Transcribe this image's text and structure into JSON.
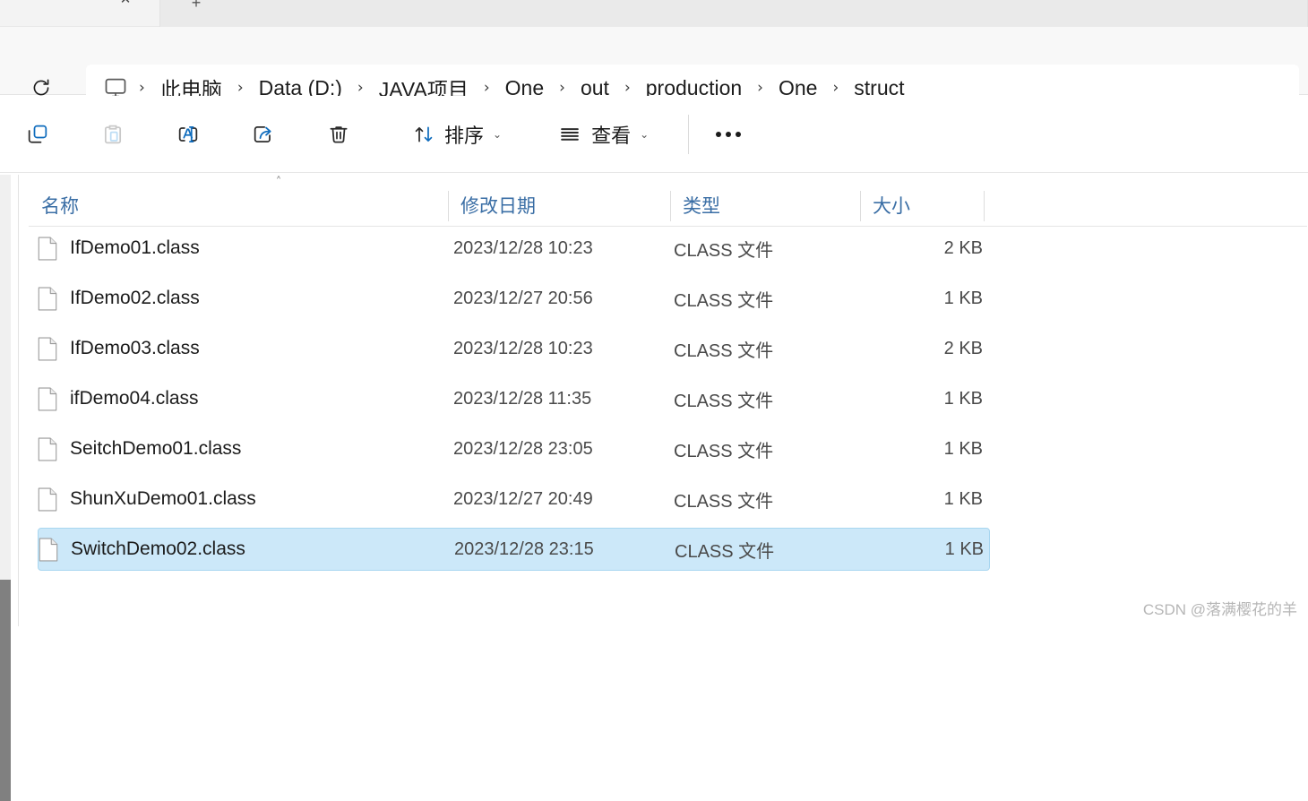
{
  "tabstrip": {
    "close_label": "✕",
    "new_tab_label": "+"
  },
  "address": {
    "refresh_icon": "refresh-icon",
    "pc_icon": "this-pc-monitor-icon",
    "separator": "›",
    "breadcrumbs": [
      "此电脑",
      "Data (D:)",
      "JAVA项目",
      "One",
      "out",
      "production",
      "One",
      "struct"
    ]
  },
  "toolbar": {
    "icons": [
      {
        "name": "copy-icon",
        "state": "enabled"
      },
      {
        "name": "paste-icon",
        "state": "disabled"
      },
      {
        "name": "rename-icon",
        "state": "enabled"
      },
      {
        "name": "share-icon",
        "state": "enabled"
      },
      {
        "name": "delete-icon",
        "state": "enabled"
      }
    ],
    "sort_label": "排序",
    "view_label": "查看",
    "chevron": "⌄",
    "more_label": "•••"
  },
  "columns": {
    "headers": [
      "名称",
      "修改日期",
      "类型",
      "大小"
    ],
    "sort_indicator": "˄",
    "sort_column": "名称",
    "sort_direction": "ascending"
  },
  "files": [
    {
      "name": "IfDemo01.class",
      "date": "2023/12/28 10:23",
      "type": "CLASS 文件",
      "size": "2 KB",
      "selected": false
    },
    {
      "name": "IfDemo02.class",
      "date": "2023/12/27 20:56",
      "type": "CLASS 文件",
      "size": "1 KB",
      "selected": false
    },
    {
      "name": "IfDemo03.class",
      "date": "2023/12/28 10:23",
      "type": "CLASS 文件",
      "size": "2 KB",
      "selected": false
    },
    {
      "name": "ifDemo04.class",
      "date": "2023/12/28 11:35",
      "type": "CLASS 文件",
      "size": "1 KB",
      "selected": false
    },
    {
      "name": "SeitchDemo01.class",
      "date": "2023/12/28 23:05",
      "type": "CLASS 文件",
      "size": "1 KB",
      "selected": false
    },
    {
      "name": "ShunXuDemo01.class",
      "date": "2023/12/27 20:49",
      "type": "CLASS 文件",
      "size": "1 KB",
      "selected": false
    },
    {
      "name": "SwitchDemo02.class",
      "date": "2023/12/28 23:15",
      "type": "CLASS 文件",
      "size": "1 KB",
      "selected": true
    }
  ],
  "watermark": "CSDN @落满樱花的羊",
  "colors": {
    "selection_fill": "#cce8f9",
    "selection_border": "#a8d6f0",
    "header_text": "#3a6ea5",
    "accent_blue": "#0f6cbd",
    "scrollbar_thumb": "#808080"
  }
}
